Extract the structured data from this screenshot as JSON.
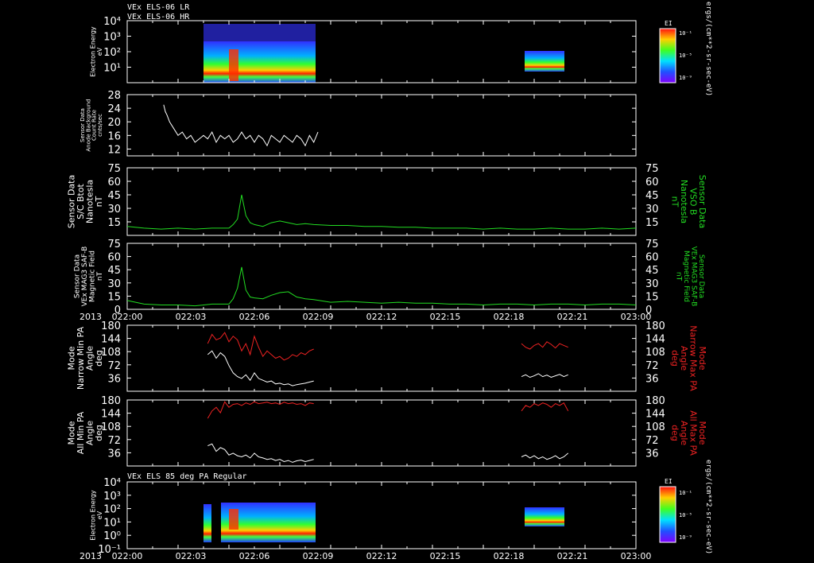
{
  "colors": {
    "background": "#000000",
    "axes": "#ffffff",
    "white_trace": "#ffffff",
    "green_trace": "#22dd22",
    "red_trace": "#ee2222"
  },
  "x_axis": {
    "year_label": "2013",
    "tick_labels": [
      "022:00",
      "022:03",
      "022:06",
      "022:09",
      "022:12",
      "022:15",
      "022:18",
      "022:21",
      "023:00"
    ],
    "range_minutes": [
      0,
      60
    ]
  },
  "headers": {
    "top": [
      "VEx ELS-06 LR",
      "VEx ELS-06 HR"
    ],
    "bottom": "VEx ELS 85 deg PA Regular"
  },
  "colorbar": {
    "title": "EI",
    "ticks": [
      "10⁻¹",
      "10⁻⁵",
      "10⁻⁹"
    ],
    "unit_label": "ergs/(cm**2-sr-sec-eV)"
  },
  "panels": [
    {
      "id": "els-energy-top",
      "ylabel": [
        "Electron Energy",
        "eV"
      ],
      "yticks_left": [
        "10⁴",
        "10³",
        "10²",
        "10¹"
      ]
    },
    {
      "id": "anode-background",
      "ylabel": [
        "Sensor Data",
        "Anode Background",
        "Count Rate",
        "cnts/sec"
      ],
      "yticks_left": [
        "28",
        "24",
        "20",
        "16",
        "12"
      ]
    },
    {
      "id": "btot",
      "ylabel": [
        "Sensor Data",
        "S/C Btot",
        "Nanotesla",
        "nT"
      ],
      "yticks_left": [
        "75",
        "60",
        "45",
        "30",
        "15"
      ],
      "yticks_right": [
        "75",
        "60",
        "45",
        "30",
        "15"
      ],
      "right_label": [
        "Sensor Data",
        "VSO B",
        "Nanotesla",
        "nT"
      ]
    },
    {
      "id": "mag-field",
      "ylabel": [
        "Sensor Data",
        "VEx MAG3 SAF-B",
        "Magnetic Field",
        "nT"
      ],
      "yticks_left": [
        "75",
        "60",
        "45",
        "30",
        "15",
        "0"
      ],
      "yticks_right": [
        "75",
        "60",
        "45",
        "30",
        "15",
        "0"
      ],
      "right_label": [
        "Sensor Data",
        "VEx MAG3 SAF-B",
        "Magnetic Field",
        "nT"
      ]
    },
    {
      "id": "narrow-pa",
      "ylabel": [
        "Mode",
        "Narrow Min PA",
        "Angle",
        "deg"
      ],
      "yticks_left": [
        "180",
        "144",
        "108",
        "72",
        "36"
      ],
      "yticks_right": [
        "180",
        "144",
        "108",
        "72",
        "36"
      ],
      "right_label": [
        "Mode",
        "Narrow Max PA",
        "Angle",
        "deg"
      ]
    },
    {
      "id": "all-pa",
      "ylabel": [
        "Mode",
        "All Min PA",
        "Angle",
        "deg"
      ],
      "yticks_left": [
        "180",
        "144",
        "108",
        "72",
        "36"
      ],
      "yticks_right": [
        "180",
        "144",
        "108",
        "72",
        "36"
      ],
      "right_label": [
        "Mode",
        "All Max PA",
        "Angle",
        "deg"
      ]
    },
    {
      "id": "els-energy-bottom",
      "ylabel": [
        "Electron Energy",
        "eV"
      ],
      "yticks_left": [
        "10⁴",
        "10³",
        "10²",
        "10¹",
        "10⁰",
        "10⁻¹"
      ]
    }
  ],
  "chart_data": {
    "type": "line",
    "x_unit": "minutes after 022:00",
    "series": [
      {
        "panel": "anode-background",
        "color": "white",
        "x": [
          4.3,
          4.5,
          4.7,
          5,
          5.5,
          6,
          6.5,
          7,
          7.5,
          8,
          8.5,
          9,
          9.5,
          10,
          10.5,
          11,
          11.5,
          12,
          12.5,
          13,
          13.5,
          14,
          14.5,
          15,
          15.5,
          16,
          16.5,
          17,
          17.5,
          18,
          18.5,
          19,
          19.5,
          20,
          20.5,
          21,
          21.5,
          22,
          22.5
        ],
        "y": [
          25,
          23,
          22,
          20,
          18,
          16,
          17,
          15,
          16,
          14,
          15,
          16,
          15,
          17,
          14,
          16,
          15,
          16,
          14,
          15,
          17,
          15,
          16,
          14,
          16,
          15,
          13,
          16,
          15,
          14,
          16,
          15,
          14,
          16,
          15,
          13,
          16,
          14,
          17
        ]
      },
      {
        "panel": "btot",
        "color": "green",
        "x": [
          0,
          2,
          4,
          6,
          8,
          10,
          12,
          12.5,
          13,
          13.5,
          14,
          14.5,
          15,
          16,
          17,
          18,
          19,
          20,
          21,
          22,
          24,
          26,
          28,
          30,
          32,
          34,
          36,
          38,
          40,
          42,
          44,
          46,
          48,
          50,
          52,
          54,
          56,
          58,
          60
        ],
        "y": [
          10,
          8,
          7,
          8,
          7,
          8,
          8,
          12,
          18,
          45,
          22,
          14,
          12,
          10,
          14,
          16,
          14,
          12,
          13,
          12,
          11,
          11,
          10,
          10,
          9,
          9,
          8,
          8,
          8,
          7,
          8,
          7,
          7,
          8,
          7,
          7,
          8,
          7,
          8
        ]
      },
      {
        "panel": "mag-field",
        "color": "green",
        "x": [
          0,
          2,
          4,
          6,
          8,
          10,
          12,
          12.5,
          13,
          13.5,
          14,
          14.5,
          15,
          16,
          17,
          18,
          19,
          20,
          21,
          22,
          24,
          26,
          28,
          30,
          32,
          34,
          36,
          38,
          40,
          42,
          44,
          46,
          48,
          50,
          52,
          54,
          56,
          58,
          60
        ],
        "y": [
          10,
          6,
          5,
          5,
          4,
          6,
          6,
          12,
          24,
          48,
          22,
          14,
          13,
          12,
          16,
          19,
          20,
          14,
          12,
          11,
          8,
          9,
          8,
          7,
          8,
          7,
          7,
          6,
          6,
          5,
          6,
          6,
          5,
          6,
          6,
          5,
          6,
          6,
          5
        ]
      },
      {
        "panel": "narrow-pa",
        "color": "red",
        "x": [
          9.5,
          10,
          10.5,
          11,
          11.5,
          12,
          12.5,
          13,
          13.5,
          14,
          14.5,
          15,
          15.5,
          16,
          16.5,
          17,
          17.5,
          18,
          18.5,
          19,
          19.5,
          20,
          20.5,
          21,
          21.5,
          22
        ],
        "y": [
          130,
          155,
          140,
          145,
          160,
          135,
          150,
          140,
          110,
          130,
          100,
          150,
          120,
          95,
          110,
          100,
          90,
          95,
          85,
          90,
          100,
          95,
          105,
          100,
          110,
          115
        ]
      },
      {
        "panel": "narrow-pa",
        "color": "white",
        "x": [
          9.5,
          10,
          10.5,
          11,
          11.5,
          12,
          12.5,
          13,
          13.5,
          14,
          14.5,
          15,
          15.5,
          16,
          16.5,
          17,
          17.5,
          18,
          18.5,
          19,
          19.5,
          20,
          20.5,
          21,
          21.5,
          22
        ],
        "y": [
          100,
          110,
          90,
          105,
          95,
          70,
          50,
          40,
          35,
          45,
          30,
          50,
          35,
          30,
          25,
          28,
          20,
          22,
          18,
          20,
          15,
          18,
          20,
          22,
          25,
          28
        ]
      },
      {
        "panel": "narrow-pa",
        "color": "red",
        "x": [
          46.5,
          47,
          47.5,
          48,
          48.5,
          49,
          49.5,
          50,
          50.5,
          51,
          51.5,
          52
        ],
        "y": [
          130,
          120,
          115,
          125,
          130,
          120,
          135,
          128,
          118,
          130,
          125,
          120
        ]
      },
      {
        "panel": "narrow-pa",
        "color": "white",
        "x": [
          46.5,
          47,
          47.5,
          48,
          48.5,
          49,
          49.5,
          50,
          50.5,
          51,
          51.5,
          52
        ],
        "y": [
          40,
          45,
          38,
          42,
          48,
          40,
          44,
          38,
          42,
          46,
          40,
          45
        ]
      },
      {
        "panel": "all-pa",
        "color": "red",
        "x": [
          9.5,
          10,
          10.5,
          11,
          11.5,
          12,
          12.5,
          13,
          13.5,
          14,
          14.5,
          15,
          15.5,
          16,
          16.5,
          17,
          17.5,
          18,
          18.5,
          19,
          19.5,
          20,
          20.5,
          21,
          21.5,
          22
        ],
        "y": [
          130,
          150,
          160,
          145,
          175,
          160,
          168,
          170,
          165,
          172,
          168,
          175,
          170,
          172,
          174,
          170,
          172,
          168,
          174,
          170,
          172,
          168,
          170,
          165,
          172,
          170
        ]
      },
      {
        "panel": "all-pa",
        "color": "white",
        "x": [
          9.5,
          10,
          10.5,
          11,
          11.5,
          12,
          12.5,
          13,
          13.5,
          14,
          14.5,
          15,
          15.5,
          16,
          16.5,
          17,
          17.5,
          18,
          18.5,
          19,
          19.5,
          20,
          20.5,
          21,
          21.5,
          22
        ],
        "y": [
          55,
          60,
          40,
          50,
          45,
          30,
          35,
          28,
          25,
          30,
          22,
          35,
          25,
          22,
          18,
          20,
          15,
          18,
          12,
          15,
          10,
          14,
          16,
          12,
          15,
          18
        ]
      },
      {
        "panel": "all-pa",
        "color": "red",
        "x": [
          46.5,
          47,
          47.5,
          48,
          48.5,
          49,
          49.5,
          50,
          50.5,
          51,
          51.5,
          52
        ],
        "y": [
          150,
          165,
          160,
          170,
          165,
          172,
          168,
          160,
          170,
          165,
          172,
          150
        ]
      },
      {
        "panel": "all-pa",
        "color": "white",
        "x": [
          46.5,
          47,
          47.5,
          48,
          48.5,
          49,
          49.5,
          50,
          50.5,
          51,
          51.5,
          52
        ],
        "y": [
          25,
          30,
          22,
          28,
          20,
          25,
          18,
          22,
          28,
          20,
          25,
          35
        ]
      }
    ]
  }
}
